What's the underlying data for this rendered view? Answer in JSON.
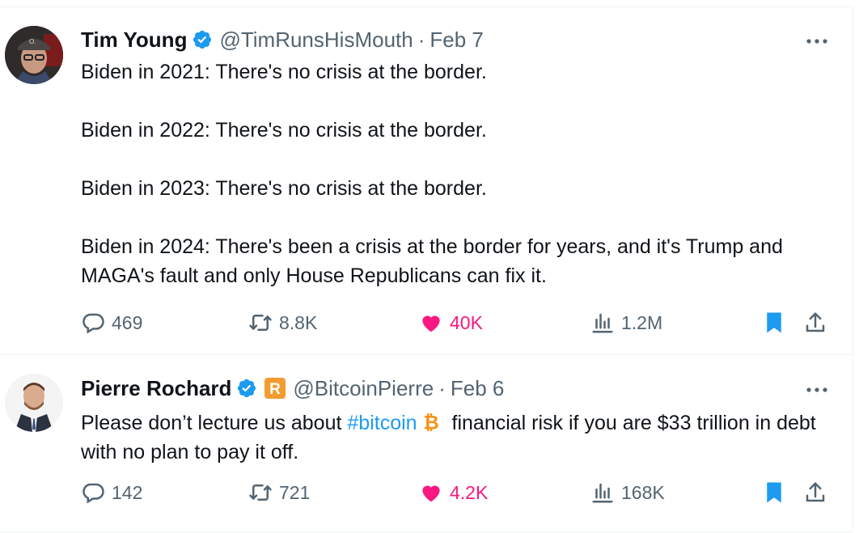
{
  "tweets": [
    {
      "author_name": "Tim Young",
      "handle": "@TimRunsHisMouth",
      "separator": "·",
      "date": "Feb 7",
      "paragraphs": [
        "Biden in 2021: There's no crisis at the border.",
        "Biden in 2022: There's no crisis at the border.",
        "Biden in 2023: There's no crisis at the border.",
        "Biden in 2024:  There's been a crisis at the border for years, and it's Trump and MAGA's fault and only House Republicans can fix it."
      ],
      "replies": "469",
      "reposts": "8.8K",
      "likes": "40K",
      "views": "1.2M",
      "liked": true,
      "bookmarked": true
    },
    {
      "author_name": "Pierre Rochard",
      "handle": "@BitcoinPierre",
      "separator": "·",
      "date": "Feb 6",
      "text_before": "Please don’t lecture us about ",
      "hashtag": "#bitcoin",
      "text_after": " financial risk if you are $33 trillion in debt with no plan to pay it off.",
      "replies": "142",
      "reposts": "721",
      "likes": "4.2K",
      "views": "168K",
      "liked": true,
      "bookmarked": true,
      "affiliate_badge_letter": "R"
    }
  ],
  "icons": {
    "verified": "verified-badge-icon",
    "more": "more-options-icon",
    "reply": "reply-bubble-icon",
    "retweet": "retweet-arrows-icon",
    "like": "heart-icon",
    "views": "analytics-bars-icon",
    "bookmark": "bookmark-icon",
    "share": "share-upload-icon",
    "bitcoin": "bitcoin-emoji-icon"
  },
  "colors": {
    "text": "#0f1419",
    "secondary": "#536471",
    "accent": "#1d9bf0",
    "like": "#f91880",
    "divider": "#eff3f4",
    "bitcoin": "#f7931a",
    "affiliate_badge": "#f39c31"
  }
}
